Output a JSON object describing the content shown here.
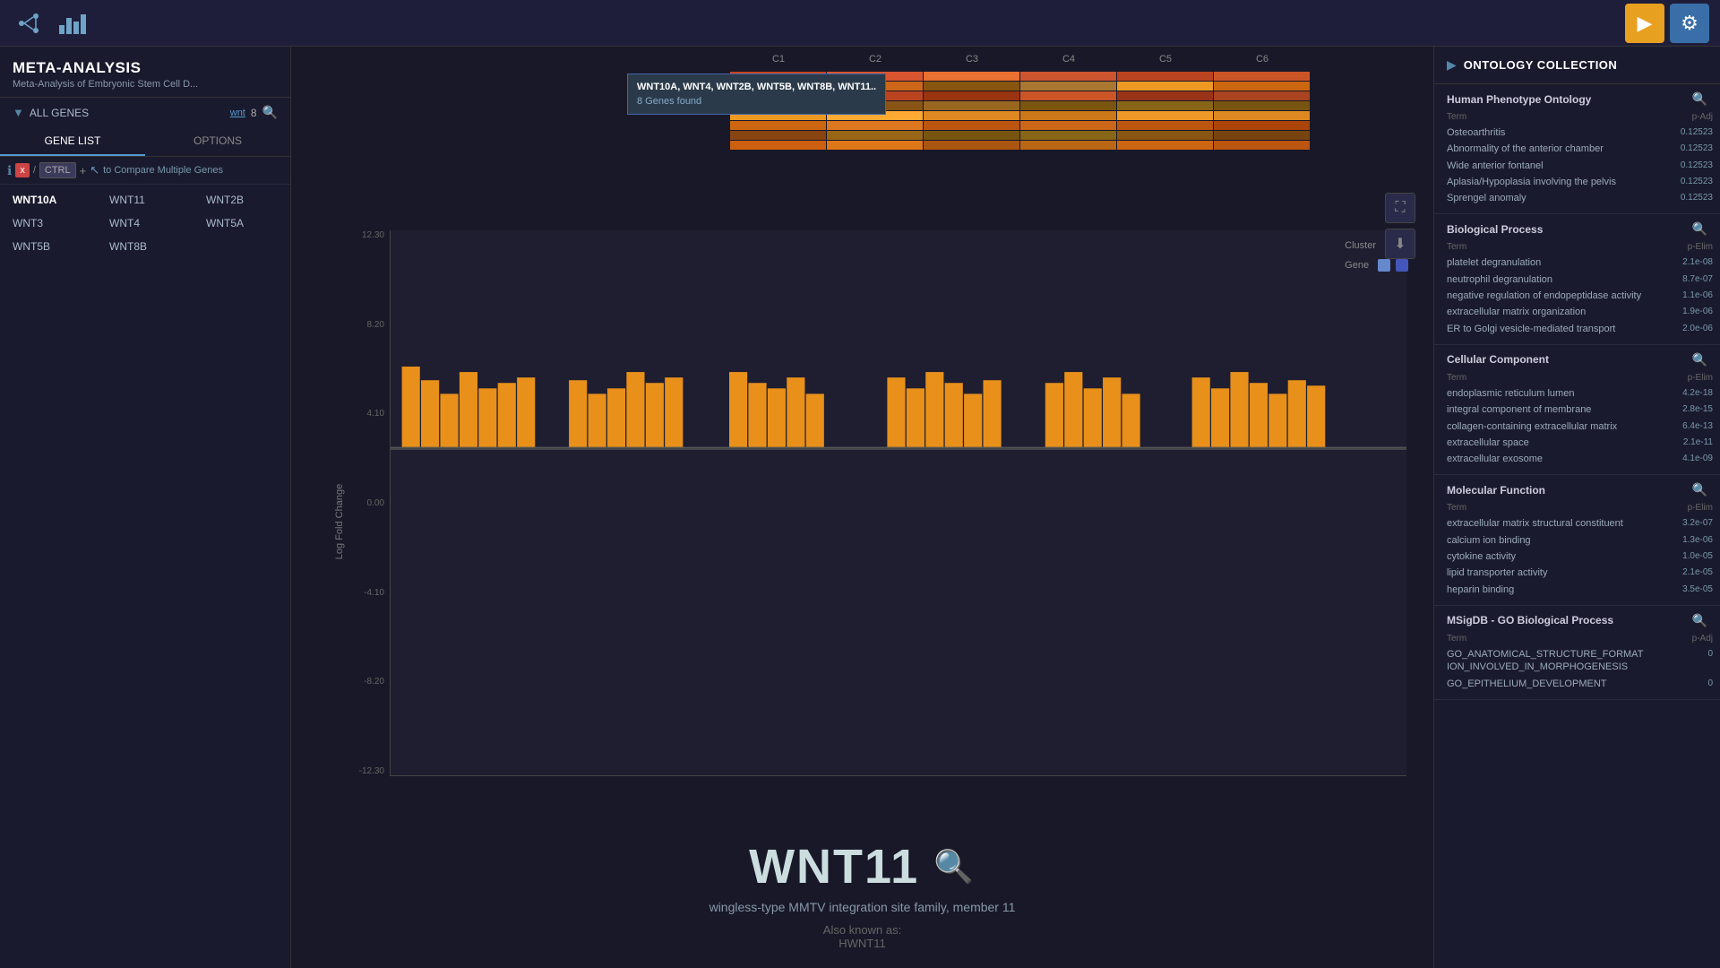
{
  "app": {
    "title": "META-ANALYSIS",
    "subtitle": "Meta-Analysis of Embryonic Stem Cell D...",
    "topbar_icon1": "≈",
    "topbar_icon2": "▬▬",
    "play_btn": "▶",
    "gear_btn": "⚙"
  },
  "sidebar": {
    "all_genes_label": "ALL GENES",
    "wnt_tag": "wnt",
    "gene_count": "8",
    "tab_gene_list": "GENE LIST",
    "tab_options": "OPTIONS",
    "toolbar_x": "x",
    "toolbar_ctrl": "CTRL",
    "toolbar_plus": "+",
    "toolbar_compare": "to Compare Multiple Genes",
    "genes": [
      {
        "id": "WNT10A",
        "col": 0,
        "row": 0,
        "selected": true
      },
      {
        "id": "WNT11",
        "col": 1,
        "row": 0,
        "selected": false
      },
      {
        "id": "WNT2B",
        "col": 2,
        "row": 0,
        "selected": false
      },
      {
        "id": "WNT3",
        "col": 0,
        "row": 1,
        "selected": false
      },
      {
        "id": "WNT4",
        "col": 1,
        "row": 1,
        "selected": false
      },
      {
        "id": "WNT5A",
        "col": 2,
        "row": 1,
        "selected": false
      },
      {
        "id": "WNT5B",
        "col": 0,
        "row": 2,
        "selected": false
      },
      {
        "id": "WNT8B",
        "col": 1,
        "row": 2,
        "selected": false
      }
    ]
  },
  "heatmap": {
    "columns": [
      "C1",
      "C2",
      "C3",
      "C4",
      "C5",
      "C6"
    ],
    "tooltip": {
      "genes": "WNT10A, WNT4, WNT2B, WNT5B, WNT8B, WNT11..",
      "found": "8 Genes found"
    }
  },
  "chart": {
    "y_label": "Log Fold Change",
    "y_ticks": [
      "12.30",
      "8.20",
      "4.10",
      "0.00",
      "-4.10",
      "-8.20",
      "-12.30"
    ],
    "zero_position_pct": 40
  },
  "gene_info": {
    "name": "WNT11",
    "description": "wingless-type MMTV integration site family, member 11",
    "also_known_as_label": "Also known as:",
    "also_known_as": "HWNT11"
  },
  "legend": {
    "cluster_label": "Cluster",
    "gene_label": "Gene",
    "cluster_color1": "#4466cc",
    "cluster_color2": "#7755cc",
    "gene_color1": "#6688cc",
    "gene_color2": "#4455bb"
  },
  "ontology": {
    "title": "ONTOLOGY COLLECTION",
    "sections": [
      {
        "title": "Human Phenotype Ontology",
        "col_term": "Term",
        "col_value": "p-Adj",
        "rows": [
          {
            "term": "Osteoarthritis",
            "value": "0.12523"
          },
          {
            "term": "Abnormality of the anterior chamber",
            "value": "0.12523"
          },
          {
            "term": "Wide anterior fontanel",
            "value": "0.12523"
          },
          {
            "term": "Aplasia/Hypoplasia involving the pelvis",
            "value": "0.12523"
          },
          {
            "term": "Sprengel anomaly",
            "value": "0.12523"
          }
        ]
      },
      {
        "title": "Biological Process",
        "col_term": "Term",
        "col_value": "p-Elim",
        "rows": [
          {
            "term": "platelet degranulation",
            "value": "2.1e-08"
          },
          {
            "term": "neutrophil degranulation",
            "value": "8.7e-07"
          },
          {
            "term": "negative regulation of endopeptidase activity",
            "value": "1.1e-06"
          },
          {
            "term": "extracellular matrix organization",
            "value": "1.9e-06"
          },
          {
            "term": "ER to Golgi vesicle-mediated transport",
            "value": "2.0e-06"
          }
        ]
      },
      {
        "title": "Cellular Component",
        "col_term": "Term",
        "col_value": "p-Elim",
        "rows": [
          {
            "term": "endoplasmic reticulum lumen",
            "value": "4.2e-18"
          },
          {
            "term": "integral component of membrane",
            "value": "2.8e-15"
          },
          {
            "term": "collagen-containing extracellular matrix",
            "value": "6.4e-13"
          },
          {
            "term": "extracellular space",
            "value": "2.1e-11"
          },
          {
            "term": "extracellular exosome",
            "value": "4.1e-09"
          }
        ]
      },
      {
        "title": "Molecular Function",
        "col_term": "Term",
        "col_value": "p-Elim",
        "rows": [
          {
            "term": "extracellular matrix structural constituent",
            "value": "3.2e-07"
          },
          {
            "term": "calcium ion binding",
            "value": "1.3e-06"
          },
          {
            "term": "cytokine activity",
            "value": "1.0e-05"
          },
          {
            "term": "lipid transporter activity",
            "value": "2.1e-05"
          },
          {
            "term": "heparin binding",
            "value": "3.5e-05"
          }
        ]
      },
      {
        "title": "MSigDB - GO Biological Process",
        "col_term": "Term",
        "col_value": "p-Adj",
        "rows": [
          {
            "term": "GO_ANATOMICAL_STRUCTURE_FORMAT ION_INVOLVED_IN_MORPHOGENESIS",
            "value": "0"
          },
          {
            "term": "GO_EPITHELIUM_DEVELOPMENT",
            "value": "0"
          }
        ]
      }
    ]
  }
}
